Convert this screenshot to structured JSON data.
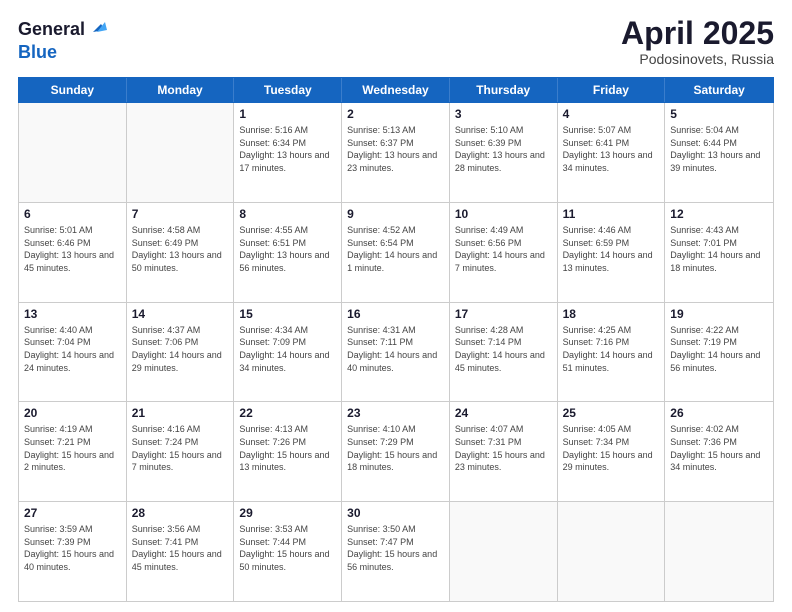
{
  "header": {
    "logo_general": "General",
    "logo_blue": "Blue",
    "title": "April 2025",
    "location": "Podosinovets, Russia"
  },
  "calendar": {
    "days_of_week": [
      "Sunday",
      "Monday",
      "Tuesday",
      "Wednesday",
      "Thursday",
      "Friday",
      "Saturday"
    ],
    "weeks": [
      [
        {
          "day": "",
          "empty": true
        },
        {
          "day": "",
          "empty": true
        },
        {
          "day": "1",
          "sunrise": "Sunrise: 5:16 AM",
          "sunset": "Sunset: 6:34 PM",
          "daylight": "Daylight: 13 hours and 17 minutes."
        },
        {
          "day": "2",
          "sunrise": "Sunrise: 5:13 AM",
          "sunset": "Sunset: 6:37 PM",
          "daylight": "Daylight: 13 hours and 23 minutes."
        },
        {
          "day": "3",
          "sunrise": "Sunrise: 5:10 AM",
          "sunset": "Sunset: 6:39 PM",
          "daylight": "Daylight: 13 hours and 28 minutes."
        },
        {
          "day": "4",
          "sunrise": "Sunrise: 5:07 AM",
          "sunset": "Sunset: 6:41 PM",
          "daylight": "Daylight: 13 hours and 34 minutes."
        },
        {
          "day": "5",
          "sunrise": "Sunrise: 5:04 AM",
          "sunset": "Sunset: 6:44 PM",
          "daylight": "Daylight: 13 hours and 39 minutes."
        }
      ],
      [
        {
          "day": "6",
          "sunrise": "Sunrise: 5:01 AM",
          "sunset": "Sunset: 6:46 PM",
          "daylight": "Daylight: 13 hours and 45 minutes."
        },
        {
          "day": "7",
          "sunrise": "Sunrise: 4:58 AM",
          "sunset": "Sunset: 6:49 PM",
          "daylight": "Daylight: 13 hours and 50 minutes."
        },
        {
          "day": "8",
          "sunrise": "Sunrise: 4:55 AM",
          "sunset": "Sunset: 6:51 PM",
          "daylight": "Daylight: 13 hours and 56 minutes."
        },
        {
          "day": "9",
          "sunrise": "Sunrise: 4:52 AM",
          "sunset": "Sunset: 6:54 PM",
          "daylight": "Daylight: 14 hours and 1 minute."
        },
        {
          "day": "10",
          "sunrise": "Sunrise: 4:49 AM",
          "sunset": "Sunset: 6:56 PM",
          "daylight": "Daylight: 14 hours and 7 minutes."
        },
        {
          "day": "11",
          "sunrise": "Sunrise: 4:46 AM",
          "sunset": "Sunset: 6:59 PM",
          "daylight": "Daylight: 14 hours and 13 minutes."
        },
        {
          "day": "12",
          "sunrise": "Sunrise: 4:43 AM",
          "sunset": "Sunset: 7:01 PM",
          "daylight": "Daylight: 14 hours and 18 minutes."
        }
      ],
      [
        {
          "day": "13",
          "sunrise": "Sunrise: 4:40 AM",
          "sunset": "Sunset: 7:04 PM",
          "daylight": "Daylight: 14 hours and 24 minutes."
        },
        {
          "day": "14",
          "sunrise": "Sunrise: 4:37 AM",
          "sunset": "Sunset: 7:06 PM",
          "daylight": "Daylight: 14 hours and 29 minutes."
        },
        {
          "day": "15",
          "sunrise": "Sunrise: 4:34 AM",
          "sunset": "Sunset: 7:09 PM",
          "daylight": "Daylight: 14 hours and 34 minutes."
        },
        {
          "day": "16",
          "sunrise": "Sunrise: 4:31 AM",
          "sunset": "Sunset: 7:11 PM",
          "daylight": "Daylight: 14 hours and 40 minutes."
        },
        {
          "day": "17",
          "sunrise": "Sunrise: 4:28 AM",
          "sunset": "Sunset: 7:14 PM",
          "daylight": "Daylight: 14 hours and 45 minutes."
        },
        {
          "day": "18",
          "sunrise": "Sunrise: 4:25 AM",
          "sunset": "Sunset: 7:16 PM",
          "daylight": "Daylight: 14 hours and 51 minutes."
        },
        {
          "day": "19",
          "sunrise": "Sunrise: 4:22 AM",
          "sunset": "Sunset: 7:19 PM",
          "daylight": "Daylight: 14 hours and 56 minutes."
        }
      ],
      [
        {
          "day": "20",
          "sunrise": "Sunrise: 4:19 AM",
          "sunset": "Sunset: 7:21 PM",
          "daylight": "Daylight: 15 hours and 2 minutes."
        },
        {
          "day": "21",
          "sunrise": "Sunrise: 4:16 AM",
          "sunset": "Sunset: 7:24 PM",
          "daylight": "Daylight: 15 hours and 7 minutes."
        },
        {
          "day": "22",
          "sunrise": "Sunrise: 4:13 AM",
          "sunset": "Sunset: 7:26 PM",
          "daylight": "Daylight: 15 hours and 13 minutes."
        },
        {
          "day": "23",
          "sunrise": "Sunrise: 4:10 AM",
          "sunset": "Sunset: 7:29 PM",
          "daylight": "Daylight: 15 hours and 18 minutes."
        },
        {
          "day": "24",
          "sunrise": "Sunrise: 4:07 AM",
          "sunset": "Sunset: 7:31 PM",
          "daylight": "Daylight: 15 hours and 23 minutes."
        },
        {
          "day": "25",
          "sunrise": "Sunrise: 4:05 AM",
          "sunset": "Sunset: 7:34 PM",
          "daylight": "Daylight: 15 hours and 29 minutes."
        },
        {
          "day": "26",
          "sunrise": "Sunrise: 4:02 AM",
          "sunset": "Sunset: 7:36 PM",
          "daylight": "Daylight: 15 hours and 34 minutes."
        }
      ],
      [
        {
          "day": "27",
          "sunrise": "Sunrise: 3:59 AM",
          "sunset": "Sunset: 7:39 PM",
          "daylight": "Daylight: 15 hours and 40 minutes."
        },
        {
          "day": "28",
          "sunrise": "Sunrise: 3:56 AM",
          "sunset": "Sunset: 7:41 PM",
          "daylight": "Daylight: 15 hours and 45 minutes."
        },
        {
          "day": "29",
          "sunrise": "Sunrise: 3:53 AM",
          "sunset": "Sunset: 7:44 PM",
          "daylight": "Daylight: 15 hours and 50 minutes."
        },
        {
          "day": "30",
          "sunrise": "Sunrise: 3:50 AM",
          "sunset": "Sunset: 7:47 PM",
          "daylight": "Daylight: 15 hours and 56 minutes."
        },
        {
          "day": "",
          "empty": true
        },
        {
          "day": "",
          "empty": true
        },
        {
          "day": "",
          "empty": true
        }
      ]
    ]
  }
}
